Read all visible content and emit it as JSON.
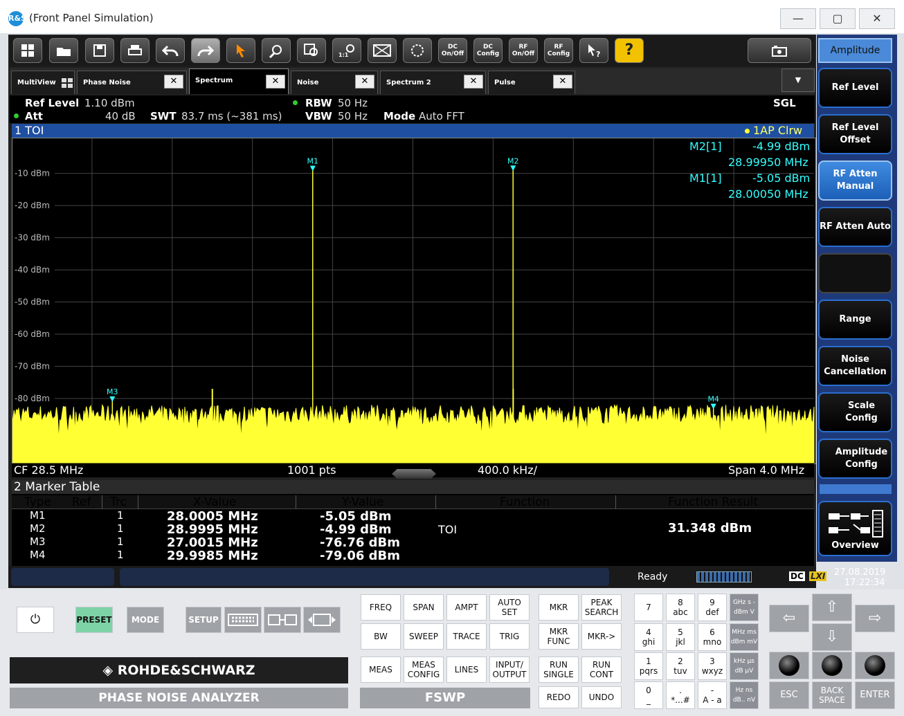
{
  "window": {
    "title": "(Front Panel Simulation)"
  },
  "toolbar": {
    "buttons": [
      {
        "name": "windows-icon"
      },
      {
        "name": "open-icon"
      },
      {
        "name": "save-icon"
      },
      {
        "name": "print-icon"
      },
      {
        "name": "undo-icon"
      },
      {
        "name": "redo-icon"
      },
      {
        "name": "pointer-icon"
      },
      {
        "name": "zoom-icon"
      },
      {
        "name": "multi-zoom-icon"
      },
      {
        "name": "zoom-1-1-icon"
      },
      {
        "name": "display-icon"
      },
      {
        "name": "sequencer-icon"
      },
      {
        "label": "DC On/Off"
      },
      {
        "label": "DC Config"
      },
      {
        "label": "RF On/Off"
      },
      {
        "label": "RF Config"
      },
      {
        "name": "context-help-icon"
      },
      {
        "label": "?"
      }
    ],
    "camera": "screenshot"
  },
  "softkeys": {
    "header": "Amplitude",
    "items": [
      "Ref Level",
      "Ref Level Offset",
      "RF Atten Manual",
      "RF Atten Auto",
      "",
      "Range",
      "Noise Cancellation",
      "Scale Config",
      "Amplitude Config"
    ],
    "overview": "Overview"
  },
  "tabs": [
    {
      "label": "MultiView"
    },
    {
      "label": "Phase Noise"
    },
    {
      "label": "Spectrum"
    },
    {
      "label": "Noise"
    },
    {
      "label": "Spectrum 2"
    },
    {
      "label": "Pulse"
    }
  ],
  "info": {
    "ref_level_label": "Ref Level",
    "ref_level": "1.10 dBm",
    "att_label": "Att",
    "att": "40 dB",
    "swt_label": "SWT",
    "swt": "83.7 ms (~381 ms)",
    "rbw_label": "RBW",
    "rbw": "50 Hz",
    "vbw_label": "VBW",
    "vbw": "50 Hz",
    "mode_label": "Mode",
    "mode": "Auto FFT",
    "sgl": "SGL"
  },
  "diagram": {
    "title": "1 TOI",
    "trace_label": "1AP Clrw"
  },
  "marker_readout": [
    {
      "label": "M2[1]",
      "level": "-4.99 dBm",
      "freq": "28.99950 MHz"
    },
    {
      "label": "M1[1]",
      "level": "-5.05 dBm",
      "freq": "28.00050 MHz"
    }
  ],
  "footer": {
    "cf": "CF 28.5 MHz",
    "pts": "1001 pts",
    "div": "400.0 kHz/",
    "span": "Span 4.0 MHz"
  },
  "chart_data": {
    "type": "line",
    "xlabel": "",
    "ylabel": "",
    "xlim": [
      26.5,
      30.5
    ],
    "ylim": [
      -100,
      1.1
    ],
    "y_ticks": [
      "-10 dBm",
      "-20 dBm",
      "-30 dBm",
      "-40 dBm",
      "-50 dBm",
      "-60 dBm",
      "-70 dBm",
      "-80 dBm"
    ],
    "y_tick_values": [
      -10,
      -20,
      -30,
      -40,
      -50,
      -60,
      -70,
      -80
    ],
    "noise_floor": -87,
    "spurs": [
      {
        "x": 27.5,
        "y": -77
      },
      {
        "x": 29.0,
        "y": -77
      }
    ],
    "markers": [
      {
        "name": "M1",
        "x": 28.0005,
        "y": -5.05
      },
      {
        "name": "M2",
        "x": 28.9995,
        "y": -4.99
      },
      {
        "name": "M3",
        "x": 27.0015,
        "y": -76.76
      },
      {
        "name": "M4",
        "x": 29.9985,
        "y": -79.06
      }
    ],
    "trace_color": "#ffff33",
    "marker_color": "#33ffff"
  },
  "marker_table": {
    "title": "2 Marker Table",
    "headers": [
      "Type",
      "Ref",
      "Trc",
      "X-Value",
      "Y-Value",
      "Function",
      "Function Result"
    ],
    "rows": [
      {
        "type": "M1",
        "ref": "",
        "trc": "1",
        "x": "28.0005 MHz",
        "y": "-5.05 dBm"
      },
      {
        "type": "M2",
        "ref": "",
        "trc": "1",
        "x": "28.9995 MHz",
        "y": "-4.99 dBm"
      },
      {
        "type": "M3",
        "ref": "",
        "trc": "1",
        "x": "27.0015 MHz",
        "y": "-76.76 dBm"
      },
      {
        "type": "M4",
        "ref": "",
        "trc": "1",
        "x": "29.9985 MHz",
        "y": "-79.06 dBm"
      }
    ],
    "function": "TOI",
    "function_result": "31.348 dBm"
  },
  "status": {
    "ready": "Ready",
    "dc": "DC",
    "lxi": "LXI",
    "date": "27.08.2019",
    "time": "17:22:34"
  },
  "hardware": {
    "power": "⏻",
    "preset": "PRESET",
    "mode": "MODE",
    "setup": "SETUP",
    "brand": "ROHDE&SCHWARZ",
    "product": "PHASE NOISE ANALYZER",
    "model": "FSWP",
    "keys1": [
      "FREQ",
      "SPAN",
      "AMPT",
      "AUTO SET",
      "BW",
      "SWEEP",
      "TRACE",
      "TRIG",
      "MEAS",
      "MEAS CONFIG",
      "LINES",
      "INPUT/ OUTPUT"
    ],
    "keys2": [
      "MKR",
      "PEAK SEARCH",
      "MKR FUNC",
      "MKR->",
      "RUN SINGLE",
      "RUN CONT",
      "REDO",
      "UNDO"
    ],
    "numpad": [
      [
        "7",
        ""
      ],
      [
        "8",
        "abc"
      ],
      [
        "9",
        "def"
      ],
      [
        "4",
        "ghi"
      ],
      [
        "5",
        "jkl"
      ],
      [
        "6",
        "mno"
      ],
      [
        "1",
        "pqrs"
      ],
      [
        "2",
        "tuv"
      ],
      [
        "3",
        "wxyz"
      ],
      [
        "0",
        "_"
      ],
      [
        ".",
        "*...#"
      ],
      [
        "-",
        "A - a"
      ]
    ],
    "units": [
      "GHz s -dBm V",
      "MHz ms dBm mV",
      "kHz µs dB µV",
      "Hz ns dB.. nV"
    ],
    "esc": "ESC",
    "backspace": "BACK SPACE",
    "enter": "ENTER"
  }
}
